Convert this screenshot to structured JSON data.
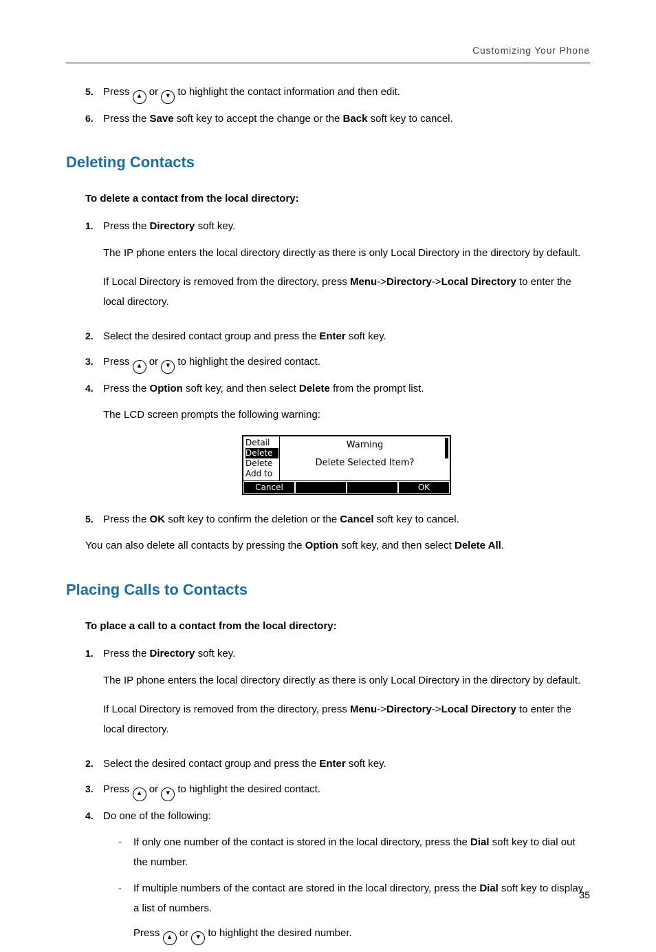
{
  "header": {
    "running": "Customizing Your Phone"
  },
  "top_steps": {
    "s5": {
      "num": "5.",
      "t1": "Press ",
      "t2": " or ",
      "t3": " to highlight the contact information and then edit."
    },
    "s6": {
      "num": "6.",
      "t1": "Press the ",
      "b1": "Save",
      "t2": " soft key to accept the change or the ",
      "b2": "Back",
      "t3": " soft key to cancel."
    }
  },
  "delete": {
    "title": "Deleting Contacts",
    "lead": "To delete a contact from the local directory:",
    "s1": {
      "num": "1.",
      "t1": "Press the ",
      "b1": "Directory",
      "t2": " soft key.",
      "p1": "The IP phone enters the local directory directly as there is only Local Directory in the directory by default.",
      "p2a": "If Local Directory is removed from the directory, press ",
      "p2b": "Menu",
      "p2c": "->",
      "p2d": "Directory",
      "p2e": "->",
      "p2f": "Local Directory",
      "p2g": " to enter the local directory."
    },
    "s2": {
      "num": "2.",
      "t1": "Select the desired contact group and press the ",
      "b1": "Enter",
      "t2": " soft key."
    },
    "s3": {
      "num": "3.",
      "t1": "Press ",
      "t2": " or ",
      "t3": " to highlight the desired contact."
    },
    "s4": {
      "num": "4.",
      "t1": "Press the ",
      "b1": "Option",
      "t2": " soft key, and then select ",
      "b2": "Delete",
      "t3": " from the prompt list.",
      "p1": "The LCD screen prompts the following warning:"
    },
    "lcd": {
      "side0": "Detail",
      "side1": "Delete",
      "side2": "Delete",
      "side3": "Add to",
      "title": "Warning",
      "prompt": "Delete Selected Item?",
      "sk_cancel": "Cancel",
      "sk_ok": "OK"
    },
    "s5": {
      "num": "5.",
      "t1": "Press the ",
      "b1": "OK",
      "t2": " soft key to confirm the deletion or the ",
      "b2": "Cancel",
      "t3": " soft key to cancel."
    },
    "after": {
      "t1": "You can also delete all contacts by pressing the ",
      "b1": "Option",
      "t2": " soft key, and then select ",
      "b2": "Delete All",
      "t3": "."
    }
  },
  "placing": {
    "title": "Placing Calls to Contacts",
    "lead": "To place a call to a contact from the local directory:",
    "s1": {
      "num": "1.",
      "t1": "Press the ",
      "b1": "Directory",
      "t2": " soft key.",
      "p1": "The IP phone enters the local directory directly as there is only Local Directory in the directory by default.",
      "p2a": "If Local Directory is removed from the directory, press ",
      "p2b": "Menu",
      "p2c": "->",
      "p2d": "Directory",
      "p2e": "->",
      "p2f": "Local Directory",
      "p2g": " to enter the local directory."
    },
    "s2": {
      "num": "2.",
      "t1": "Select the desired contact group and press the ",
      "b1": "Enter",
      "t2": " soft key."
    },
    "s3": {
      "num": "3.",
      "t1": "Press ",
      "t2": " or ",
      "t3": " to highlight the desired contact."
    },
    "s4": {
      "num": "4.",
      "t1": "Do one of the following:"
    },
    "d1": {
      "t1": "If only one number of the contact is stored in the local directory, press the ",
      "b1": "Dial",
      "t2": " soft key to dial out the number."
    },
    "d2": {
      "t1": "If multiple numbers of the contact are stored in the local directory, press the ",
      "b1": "Dial",
      "t2": " soft key to display a list of numbers."
    },
    "d2after": {
      "t1": "Press ",
      "t2": " or ",
      "t3": " to highlight the desired number."
    }
  },
  "glyph": {
    "up": "▴",
    "down": "▾",
    "dash": "-"
  },
  "page": {
    "num": "35"
  }
}
